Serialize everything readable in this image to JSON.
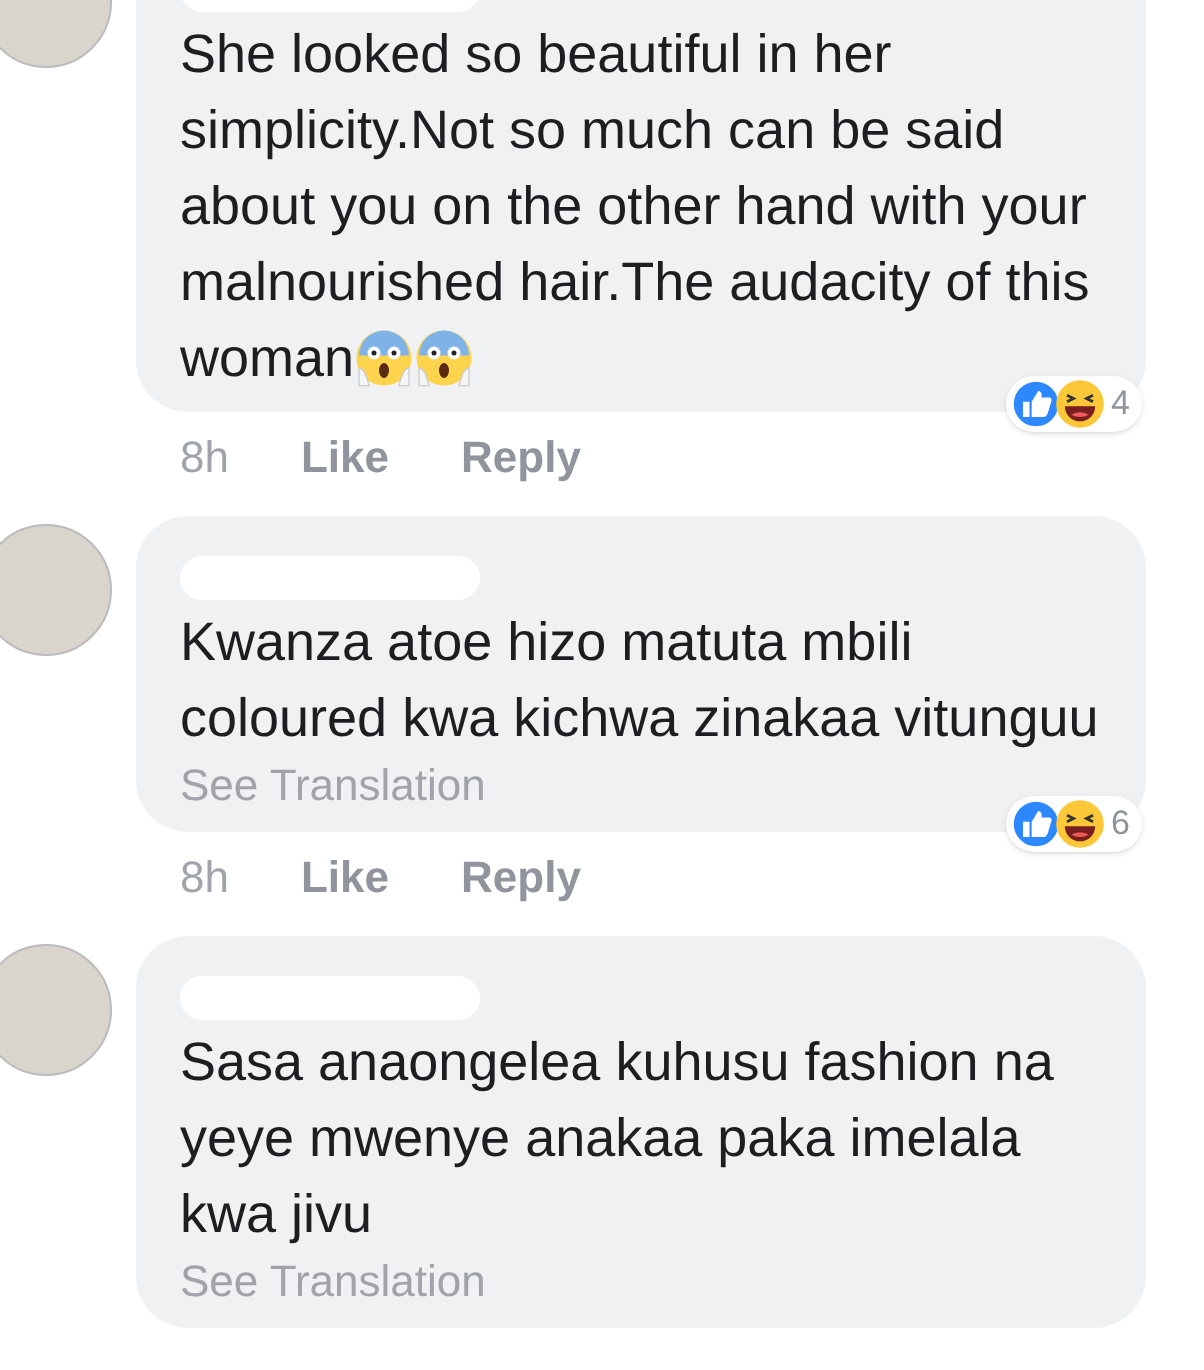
{
  "comments": [
    {
      "name_obscured": true,
      "text": "She looked so beautiful in her simplicity.Not so much can be said about you on the other hand with your malnourished hair.The audacity of this woman",
      "emoji": [
        {
          "kind": "scream"
        },
        {
          "kind": "scream"
        }
      ],
      "time": "8h",
      "like": "Like",
      "reply": "Reply",
      "reactions": {
        "types": [
          {
            "kind": "like"
          },
          {
            "kind": "haha"
          }
        ],
        "count": "4"
      }
    },
    {
      "name_obscured": true,
      "text": "Kwanza atoe hizo matuta mbili coloured kwa kichwa zinakaa vitunguu",
      "see_translation": "See Translation",
      "time": "8h",
      "like": "Like",
      "reply": "Reply",
      "reactions": {
        "types": [
          {
            "kind": "like"
          },
          {
            "kind": "haha"
          }
        ],
        "count": "6"
      }
    },
    {
      "name_obscured": true,
      "text": "Sasa anaongelea kuhusu fashion na yeye mwenye anakaa paka imelala kwa jivu",
      "see_translation": "See Translation"
    }
  ]
}
